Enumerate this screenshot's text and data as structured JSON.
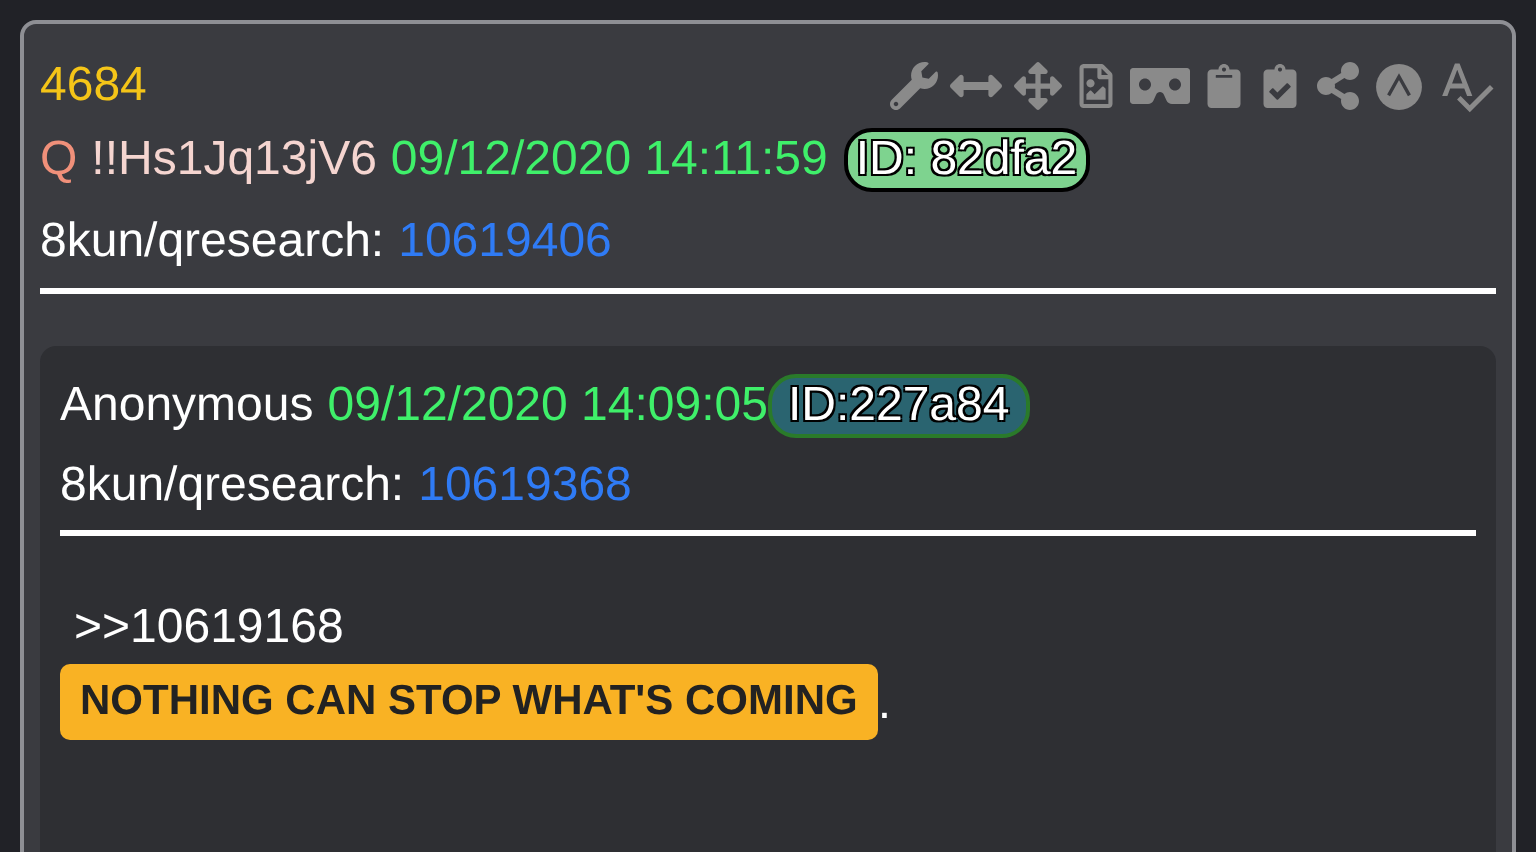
{
  "post": {
    "number": "4684",
    "name": "Q",
    "tripcode": "!!Hs1Jq13jV6",
    "timestamp": "09/12/2020 14:11:59",
    "id": "ID: 82dfa2",
    "board": "8kun/qresearch:",
    "post_link": "10619406"
  },
  "quoted_post": {
    "name": "Anonymous",
    "timestamp": "09/12/2020 14:09:05",
    "id": "ID:227a84",
    "board": "8kun/qresearch:",
    "post_link": "10619368",
    "reply_ref": ">>10619168",
    "highlight": "NOTHING CAN STOP WHAT'S COMING",
    "trailing": "."
  }
}
